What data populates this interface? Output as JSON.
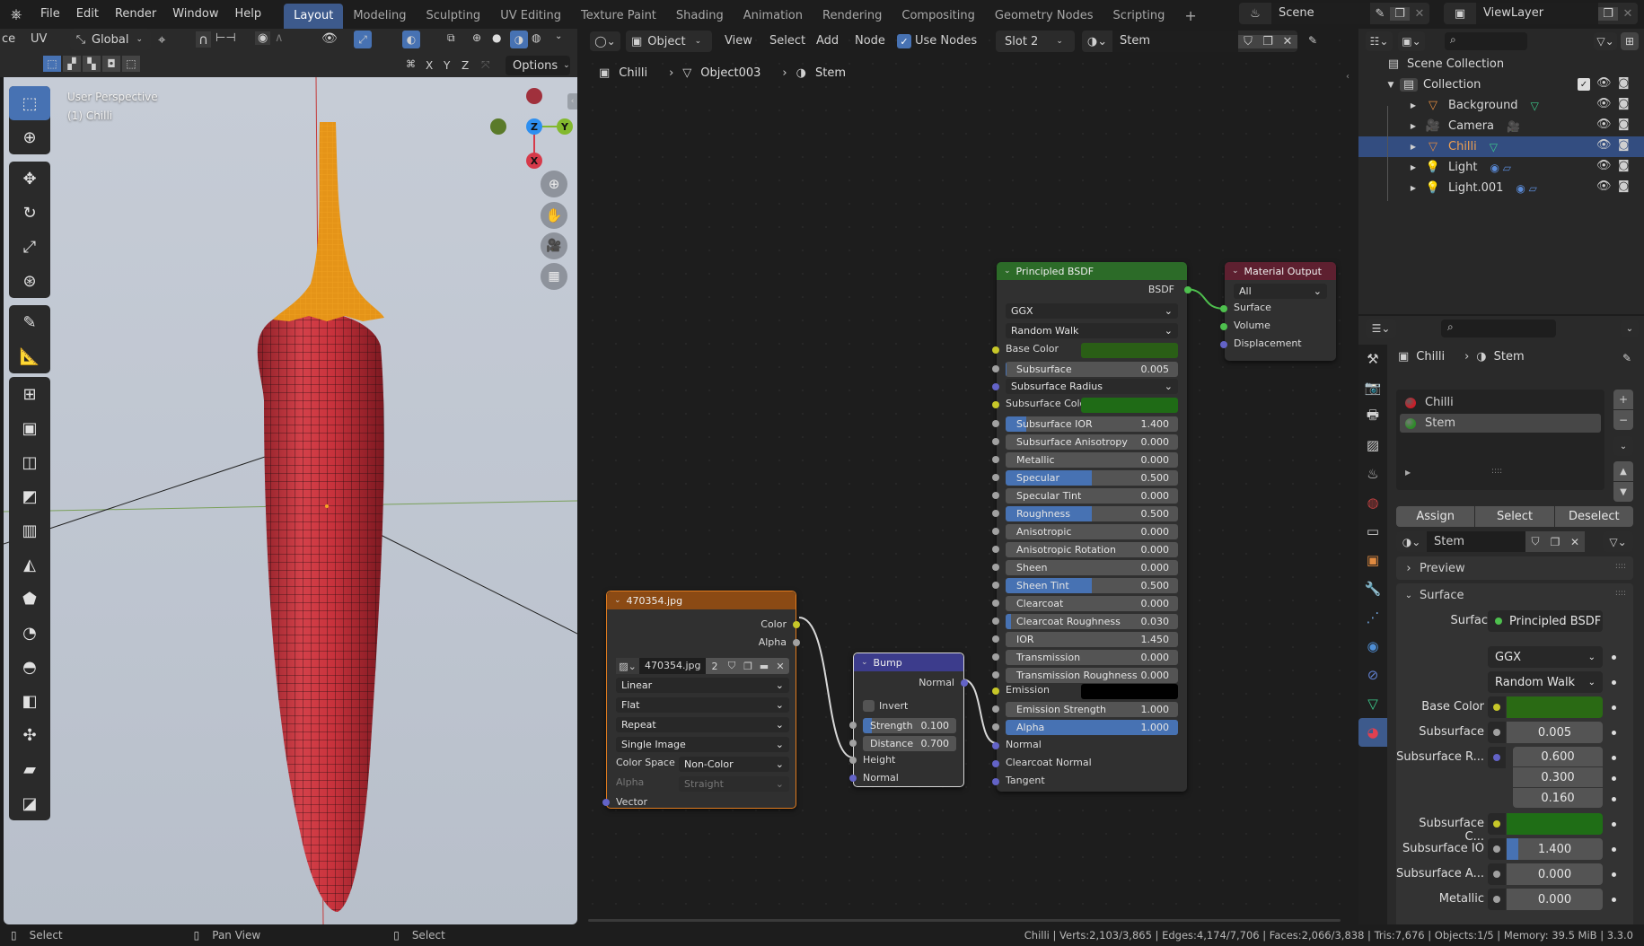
{
  "topbar": {
    "menus": [
      "File",
      "Edit",
      "Render",
      "Window",
      "Help"
    ],
    "workspace_tabs": [
      "Layout",
      "Modeling",
      "Sculpting",
      "UV Editing",
      "Texture Paint",
      "Shading",
      "Animation",
      "Rendering",
      "Compositing",
      "Geometry Nodes",
      "Scripting"
    ],
    "active_tab": "Layout",
    "add_tab": "+",
    "scene": "Scene",
    "view_layer": "ViewLayer"
  },
  "viewport": {
    "header_left_clipped": "ce",
    "uv_label": "UV",
    "transform_orientation": "Global",
    "options_label": "Options",
    "axis_buttons": [
      "X",
      "Y",
      "Z"
    ],
    "overlay_view": "User Perspective",
    "overlay_object": "(1) Chilli",
    "gizmo_axes": {
      "z": "Z",
      "y": "Y",
      "x": "X"
    },
    "colors": {
      "gizmo_z": "#2e8ff0",
      "gizmo_y": "#83b92e",
      "gizmo_x": "#d63a4a",
      "chili": "#c8323c",
      "stem": "#f0a020"
    }
  },
  "node_editor": {
    "editor_mode": "Object",
    "menus": [
      "View",
      "Select",
      "Add",
      "Node"
    ],
    "use_nodes_label": "Use Nodes",
    "use_nodes_checked": true,
    "slot": "Slot 2",
    "material": "Stem",
    "breadcrumb": [
      "Chilli",
      "Object003",
      "Stem"
    ],
    "image_node": {
      "title": "470354.jpg",
      "outputs": [
        "Color",
        "Alpha"
      ],
      "image_name": "470354.jpg",
      "users": "2",
      "interpolation": "Linear",
      "projection": "Flat",
      "extension": "Repeat",
      "source": "Single Image",
      "color_space_label": "Color Space",
      "color_space": "Non-Color",
      "alpha_label": "Alpha",
      "alpha_mode": "Straight",
      "input": "Vector"
    },
    "bump_node": {
      "title": "Bump",
      "output": "Normal",
      "invert_label": "Invert",
      "invert_checked": false,
      "strength_label": "Strength",
      "strength": "0.100",
      "strength_fraction": 0.1,
      "distance_label": "Distance",
      "distance": "0.700",
      "inputs": [
        "Height",
        "Normal"
      ]
    },
    "bsdf_node": {
      "title": "Principled BSDF",
      "output": "BSDF",
      "distribution": "GGX",
      "subsurface_method": "Random Walk",
      "base_color_label": "Base Color",
      "subsurface_radius_label": "Subsurface Radius",
      "subsurface_color_label": "Subsurface Colo",
      "emission_label": "Emission",
      "fields": [
        {
          "label": "Subsurface",
          "value": "0.005",
          "fill": 0.005
        },
        {
          "label": "Subsurface IOR",
          "value": "1.400",
          "fill": 0.12
        },
        {
          "label": "Subsurface Anisotropy",
          "value": "0.000",
          "fill": 0
        },
        {
          "label": "Metallic",
          "value": "0.000",
          "fill": 0
        },
        {
          "label": "Specular",
          "value": "0.500",
          "fill": 0.5
        },
        {
          "label": "Specular Tint",
          "value": "0.000",
          "fill": 0
        },
        {
          "label": "Roughness",
          "value": "0.500",
          "fill": 0.5
        },
        {
          "label": "Anisotropic",
          "value": "0.000",
          "fill": 0
        },
        {
          "label": "Anisotropic Rotation",
          "value": "0.000",
          "fill": 0
        },
        {
          "label": "Sheen",
          "value": "0.000",
          "fill": 0
        },
        {
          "label": "Sheen Tint",
          "value": "0.500",
          "fill": 0.5
        },
        {
          "label": "Clearcoat",
          "value": "0.000",
          "fill": 0
        },
        {
          "label": "Clearcoat Roughness",
          "value": "0.030",
          "fill": 0.03
        },
        {
          "label": "IOR",
          "value": "1.450",
          "fill": 0
        },
        {
          "label": "Transmission",
          "value": "0.000",
          "fill": 0
        },
        {
          "label": "Transmission Roughness",
          "value": "0.000",
          "fill": 0
        },
        {
          "label": "Emission Strength",
          "value": "1.000",
          "fill": 0
        },
        {
          "label": "Alpha",
          "value": "1.000",
          "fill": 1
        }
      ],
      "vector_inputs": [
        "Normal",
        "Clearcoat Normal",
        "Tangent"
      ],
      "colors": {
        "base_color": "#2a5e16",
        "subsurface_color": "#1f6b16",
        "emission": "#000000"
      }
    },
    "output_node": {
      "title": "Material Output",
      "target": "All",
      "inputs": [
        "Surface",
        "Volume",
        "Displacement"
      ]
    }
  },
  "outliner": {
    "root": "Scene Collection",
    "collection": "Collection",
    "items": [
      {
        "name": "Background",
        "type": "mesh"
      },
      {
        "name": "Camera",
        "type": "camera"
      },
      {
        "name": "Chilli",
        "type": "mesh",
        "selected": true
      },
      {
        "name": "Light",
        "type": "light"
      },
      {
        "name": "Light.001",
        "type": "light"
      }
    ]
  },
  "properties": {
    "breadcrumb": [
      "Chilli",
      "Stem"
    ],
    "material_slots": [
      {
        "name": "Chilli",
        "color": "#c8202a"
      },
      {
        "name": "Stem",
        "color": "#2f8a2a",
        "active": true
      }
    ],
    "assign": "Assign",
    "select": "Select",
    "deselect": "Deselect",
    "material_name": "Stem",
    "preview_label": "Preview",
    "surface_panel": "Surface",
    "surface_label": "Surface",
    "surface_shader": "Principled BSDF",
    "distribution": "GGX",
    "subsurface_method": "Random Walk",
    "fields": [
      {
        "label": "Base Color",
        "kind": "color",
        "color": "#2a6a14"
      },
      {
        "label": "Subsurface",
        "kind": "value",
        "value": "0.005"
      },
      {
        "label": "Subsurface R...",
        "kind": "vector",
        "values": [
          "0.600",
          "0.300",
          "0.160"
        ]
      },
      {
        "label": "Subsurface C...",
        "kind": "color",
        "color": "#1f6e16"
      },
      {
        "label": "Subsurface IO",
        "kind": "value",
        "value": "1.400",
        "fill": 0.12
      },
      {
        "label": "Subsurface A...",
        "kind": "value",
        "value": "0.000"
      },
      {
        "label": "Metallic",
        "kind": "value",
        "value": "0.000"
      }
    ]
  },
  "statusbar": {
    "left": [
      "Select",
      "Pan View",
      "Select"
    ],
    "stats": "Chilli | Verts:2,103/3,865 | Edges:4,174/7,706 | Faces:2,066/3,838 | Tris:7,676 | Objects:1/5 | Memory: 39.5 MiB | 3.3.0"
  }
}
